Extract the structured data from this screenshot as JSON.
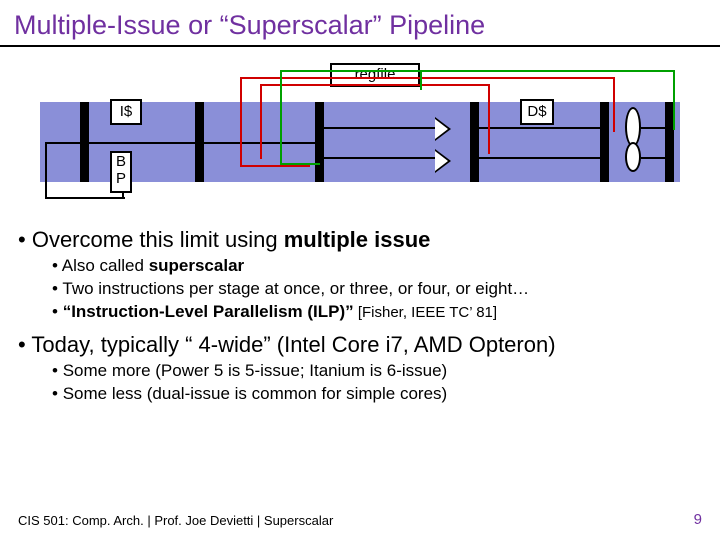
{
  "title": "Multiple-Issue or “Superscalar” Pipeline",
  "diagram": {
    "regfile": "regfile",
    "icache": "I$",
    "dcache": "D$",
    "bp_top": "B",
    "bp_bot": "P"
  },
  "bullets": {
    "l1a_pre": "Overcome this limit using ",
    "l1a_bold": "multiple issue",
    "l2a_pre": "Also called ",
    "l2a_bold": "superscalar",
    "l2b": "Two instructions per stage at once, or three, or four, or eight…",
    "l2c_bold": "“Instruction-Level Parallelism (ILP)”",
    "l2c_cite": " [Fisher, IEEE TC’ 81]",
    "l1b": "Today, typically “ 4-wide” (Intel Core i7, AMD Opteron)",
    "l2d": "Some more (Power 5 is 5-issue; Itanium is 6-issue)",
    "l2e": "Some less (dual-issue is common for simple cores)"
  },
  "footer": "CIS 501: Comp. Arch.  |  Prof. Joe Devietti  |  Superscalar",
  "page": "9"
}
